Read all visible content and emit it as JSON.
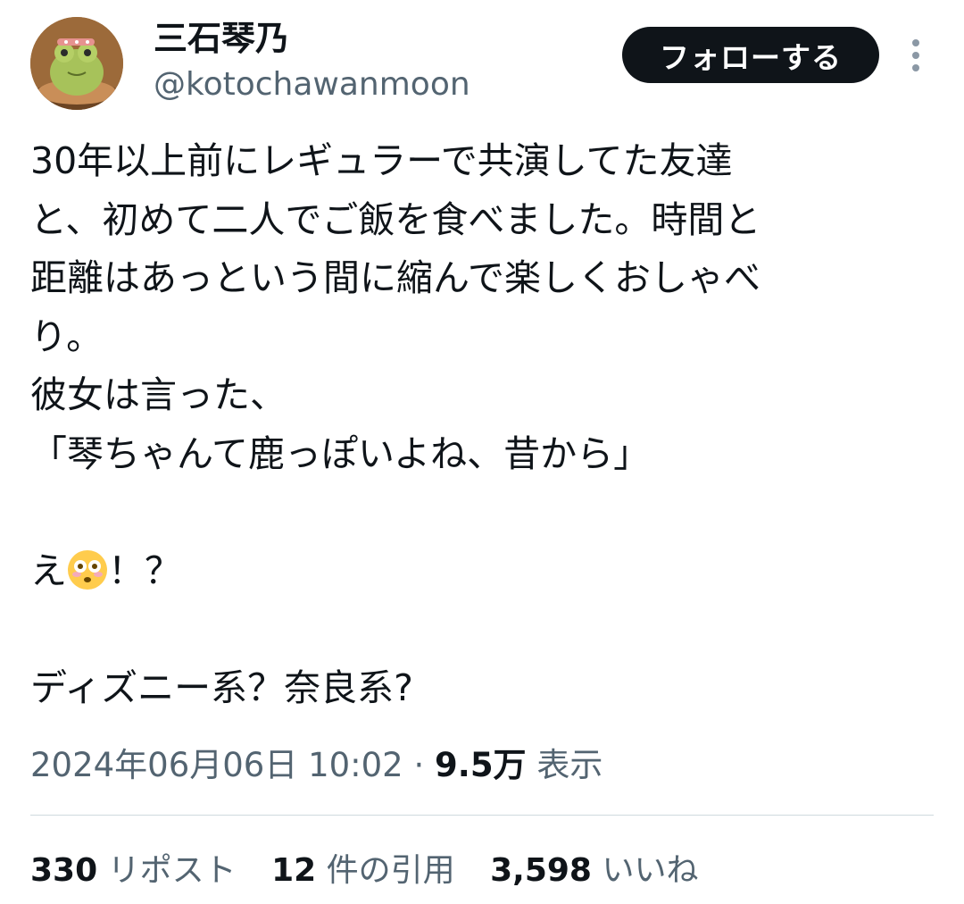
{
  "author": {
    "display_name": "三石琴乃",
    "handle": "@kotochawanmoon",
    "avatar_icon": "frog-plush-avatar"
  },
  "follow_button_label": "フォローする",
  "more_icon": "more-vertical-icon",
  "tweet": {
    "lines": [
      "30年以上前にレギュラーで共演してた友達",
      "と、初めて二人でご飯を食べました。時間と",
      "距離はあっという間に縮んで楽しくおしゃべ",
      "り。",
      "彼女は言った、",
      "「琴ちゃんて鹿っぽいよね、昔から」",
      "",
      "え",
      "",
      "ディズニー系？奈良系?"
    ],
    "emoji_line_suffix": "！？",
    "emoji_name": "flushed-face-emoji"
  },
  "meta": {
    "timestamp": "2024年06月06日 10:02",
    "separator": "·",
    "views_count": "9.5万",
    "views_label": "表示"
  },
  "stats": {
    "reposts_count": "330",
    "reposts_label": "リポスト",
    "quotes_count": "12",
    "quotes_label": "件の引用",
    "likes_count": "3,598",
    "likes_label": "いいね"
  },
  "colors": {
    "text_primary": "#0f1419",
    "text_secondary": "#536471",
    "button_bg": "#0f1419",
    "divider": "#cfd9de"
  }
}
